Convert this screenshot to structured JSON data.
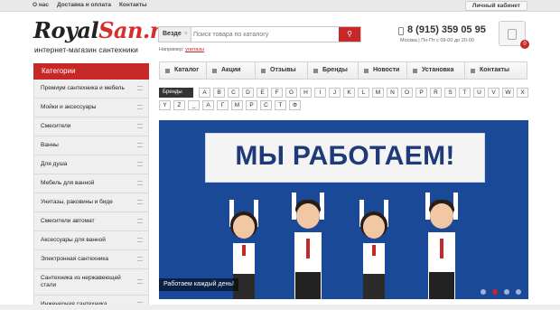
{
  "topbar": {
    "links": [
      "О нас",
      "Доставка и оплата",
      "Контакты"
    ],
    "cabinet": "Личный кабинет"
  },
  "logo": {
    "part1": "Royal",
    "part2": "San.ru"
  },
  "slogan": "интернет-магазин сантехники",
  "search": {
    "scope": "Везде",
    "scope_clear": "×",
    "placeholder": "Поиск товара по каталогу",
    "example_label": "Например:",
    "example_link": "унитазы"
  },
  "contact": {
    "phone": "8 (915) 359 05 95",
    "hours": "Москва | Пн-Пт с 09-00 до 20-00"
  },
  "cart": {
    "count": "0"
  },
  "menu": [
    "Каталог",
    "Акции",
    "Отзывы",
    "Бренды",
    "Новости",
    "Установка",
    "Контакты"
  ],
  "brands": {
    "label": "Бренды",
    "letters": [
      "A",
      "B",
      "C",
      "D",
      "E",
      "F",
      "G",
      "H",
      "I",
      "J",
      "K",
      "L",
      "M",
      "N",
      "O",
      "P",
      "R",
      "S",
      "T",
      "U",
      "V",
      "W",
      "X",
      "Y",
      "Z",
      "_",
      "А",
      "Г",
      "М",
      "Р",
      "С",
      "Т",
      "Ф"
    ]
  },
  "categories": {
    "title": "Категории",
    "items": [
      "Премиум сантехника и мебель",
      "Мойки и аксессуары",
      "Смесители",
      "Ванны",
      "Для душа",
      "Мебель для ванной",
      "Унитазы, раковины и биде",
      "Смесители автомат",
      "Аксессуары для ванной",
      "Электронная сантехника",
      "Сантехника из нержавеющей стали",
      "Инженерная сантехника"
    ]
  },
  "banner": {
    "headline": "МЫ РАБОТАЕМ!",
    "caption": "Работаем каждый день!",
    "slides": 4,
    "active_slide": 1,
    "bg_color": "#1a4a97"
  },
  "colors": {
    "accent": "#c62828",
    "text": "#333333"
  }
}
